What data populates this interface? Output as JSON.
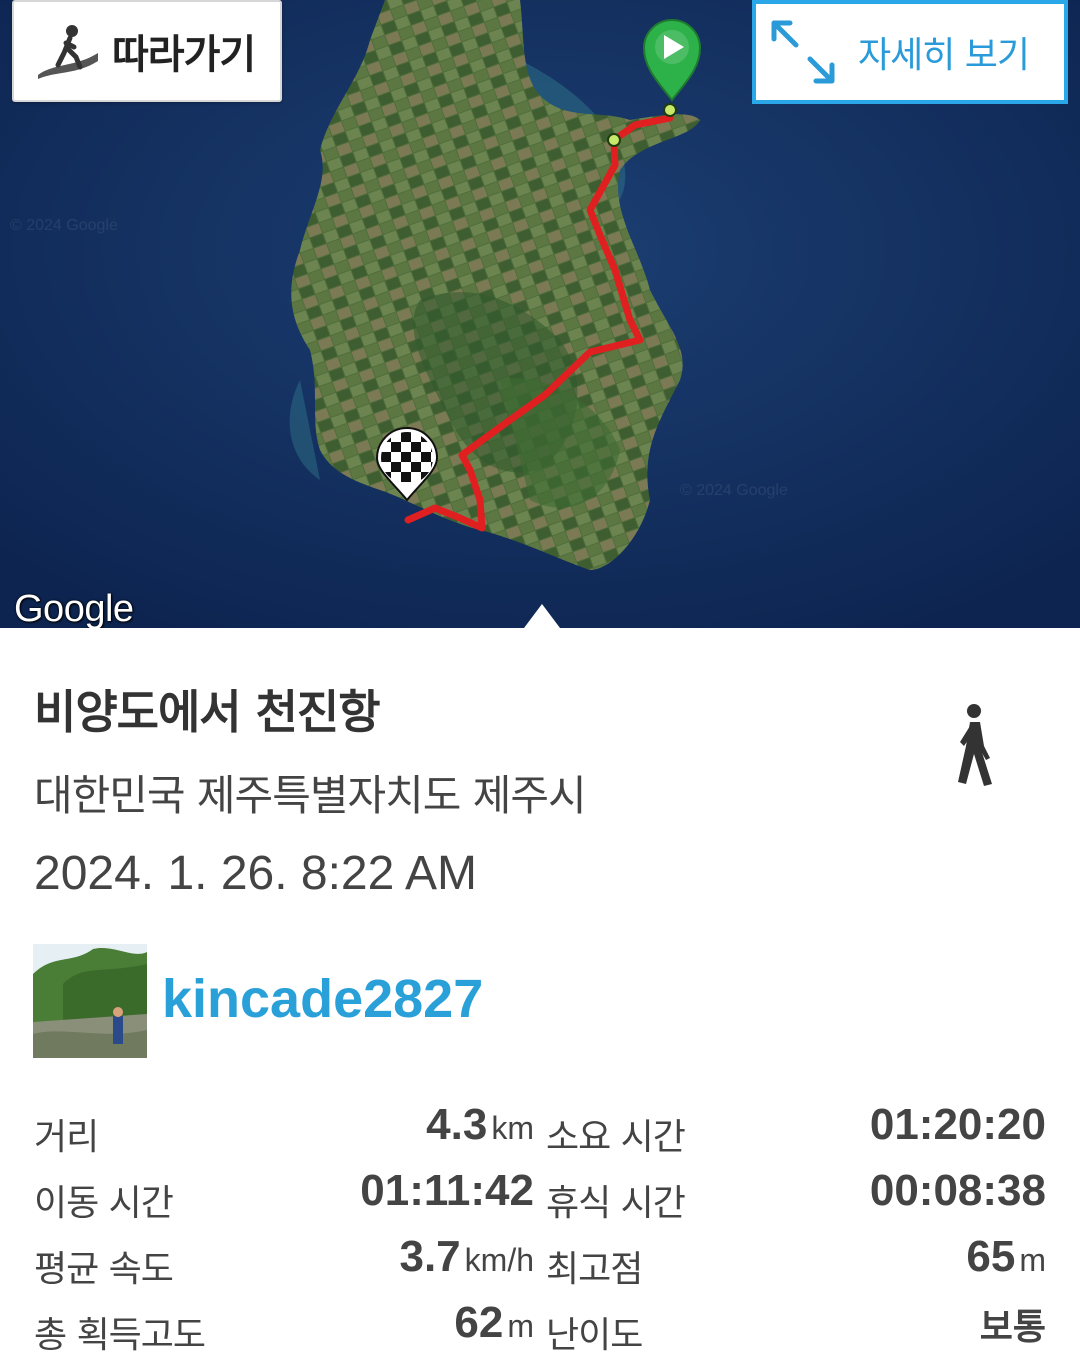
{
  "map": {
    "follow_button": "따라가기",
    "detail_button": "자세히 보기",
    "attribution": "Google"
  },
  "track": {
    "title": "비양도에서 천진항",
    "address": "대한민국 제주특별자치도 제주시",
    "datetime": "2024. 1. 26. 8:22 AM",
    "activity_icon": "walking-person-icon"
  },
  "user": {
    "name": "kincade2827"
  },
  "stats": {
    "rows": [
      {
        "label_left": "거리",
        "value_left": "4.3",
        "unit_left": "km",
        "label_right": "소요 시간",
        "value_right": "01:20:20",
        "unit_right": ""
      },
      {
        "label_left": "이동 시간",
        "value_left": "01:11:42",
        "unit_left": "",
        "label_right": "휴식 시간",
        "value_right": "00:08:38",
        "unit_right": ""
      },
      {
        "label_left": "평균 속도",
        "value_left": "3.7",
        "unit_left": "km/h",
        "label_right": "최고점",
        "value_right": "65",
        "unit_right": "m"
      },
      {
        "label_left": "총 획득고도",
        "value_left": "62",
        "unit_left": "m",
        "label_right": "난이도",
        "value_right": "보통",
        "unit_right": ""
      }
    ]
  },
  "colors": {
    "route": "#e02020",
    "accent": "#2aa0d8",
    "start_marker": "#2db24a"
  }
}
